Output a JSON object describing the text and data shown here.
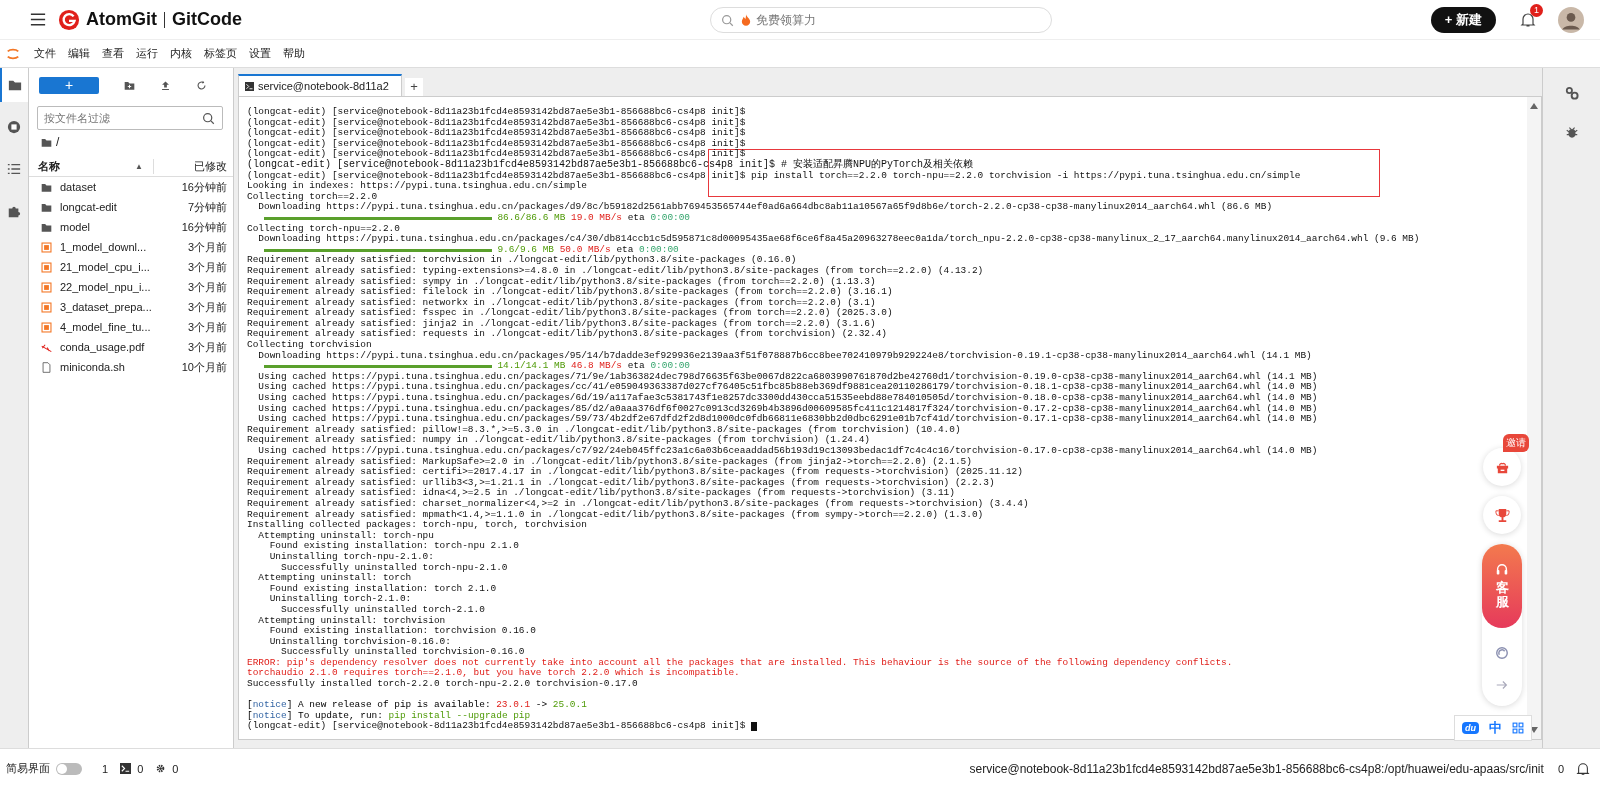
{
  "header": {
    "brand": "AtomGit",
    "brand_secondary": "GitCode",
    "search": {
      "placeholder": "免费领算力"
    },
    "new_button": {
      "icon": "+",
      "label": "新建"
    },
    "notifications": "1"
  },
  "menu": [
    "文件",
    "编辑",
    "查看",
    "运行",
    "内核",
    "标签页",
    "设置",
    "帮助"
  ],
  "activity_bar": [
    {
      "selected": true
    },
    {
      "selected": false
    },
    {
      "selected": false
    },
    {
      "selected": false
    }
  ],
  "file_browser": {
    "new_label": "+",
    "filter": {
      "placeholder": "按文件名过滤"
    },
    "path": "/",
    "columns": {
      "name": "名称",
      "sort": "▲",
      "modified": "已修改"
    },
    "files": [
      {
        "kind": "folder",
        "name": "dataset",
        "modified": "16分钟前"
      },
      {
        "kind": "folder",
        "name": "longcat-edit",
        "modified": "7分钟前"
      },
      {
        "kind": "folder",
        "name": "model",
        "modified": "16分钟前"
      },
      {
        "kind": "notebook",
        "name": "1_model_downl...",
        "modified": "3个月前"
      },
      {
        "kind": "notebook",
        "name": "21_model_cpu_i...",
        "modified": "3个月前"
      },
      {
        "kind": "notebook",
        "name": "22_model_npu_i...",
        "modified": "3个月前"
      },
      {
        "kind": "notebook",
        "name": "3_dataset_prepa...",
        "modified": "3个月前"
      },
      {
        "kind": "notebook",
        "name": "4_model_fine_tu...",
        "modified": "3个月前"
      },
      {
        "kind": "pdf",
        "name": "conda_usage.pdf",
        "modified": "3个月前"
      },
      {
        "kind": "file",
        "name": "miniconda.sh",
        "modified": "10个月前"
      }
    ]
  },
  "tabs": [
    {
      "label": "service@notebook-8d11a2",
      "selected": true
    }
  ],
  "add_tab": "+",
  "terminal": {
    "highlight_box": true,
    "lines": [
      {
        "kind": "out",
        "text": "(longcat-edit) [service@notebook-8d11a23b1fcd4e8593142bd87ae5e3b1-856688bc6-cs4p8 init]$"
      },
      {
        "kind": "out",
        "text": "(longcat-edit) [service@notebook-8d11a23b1fcd4e8593142bd87ae5e3b1-856688bc6-cs4p8 init]$"
      },
      {
        "kind": "out",
        "text": "(longcat-edit) [service@notebook-8d11a23b1fcd4e8593142bd87ae5e3b1-856688bc6-cs4p8 init]$"
      },
      {
        "kind": "out",
        "text": "(longcat-edit) [service@notebook-8d11a23b1fcd4e8593142bd87ae5e3b1-856688bc6-cs4p8 init]$"
      },
      {
        "kind": "out",
        "text": "(longcat-edit) [service@notebook-8d11a23b1fcd4e8593142bd87ae5e3b1-856688bc6-cs4p8 init]$"
      },
      {
        "kind": "out",
        "text": "(longcat-edit) [service@notebook-8d11a23b1fcd4e8593142bd87ae5e3b1-856688bc6-cs4p8 init]$ # 安装适配昇腾NPU的PyTorch及相关依赖"
      },
      {
        "kind": "out",
        "text": "(longcat-edit) [service@notebook-8d11a23b1fcd4e8593142bd87ae5e3b1-856688bc6-cs4p8 init]$ pip install torch==2.2.0 torch-npu==2.2.0 torchvision -i https://pypi.tuna.tsinghua.edu.cn/simple"
      },
      {
        "kind": "out",
        "text": "Looking in indexes: https://pypi.tuna.tsinghua.edu.cn/simple"
      },
      {
        "kind": "out",
        "text": "Collecting torch==2.2.0"
      },
      {
        "kind": "out",
        "text": "  Downloading https://pypi.tuna.tsinghua.edu.cn/packages/d9/8c/b59182d2561abb769453565744ef0ad6a664dbc8ab11a10567a65f9d8b6e/torch-2.2.0-cp38-cp38-manylinux2014_aarch64.whl (86.6 MB)"
      },
      {
        "kind": "progress",
        "level": 1,
        "size": "86.6/86.6 MB",
        "rate": "19.0 MB/s",
        "eta_label": "eta",
        "eta": "0:00:00"
      },
      {
        "kind": "out",
        "text": "Collecting torch-npu==2.2.0"
      },
      {
        "kind": "out",
        "text": "  Downloading https://pypi.tuna.tsinghua.edu.cn/packages/c4/30/db814ccb1c5d595871c8d00095435ae68f6ce6f8a45a20963278eec0a1da/torch_npu-2.2.0-cp38-cp38-manylinux_2_17_aarch64.manylinux2014_aarch64.whl (9.6 MB)"
      },
      {
        "kind": "progress",
        "level": 1,
        "size": "9.6/9.6 MB",
        "rate": "50.0 MB/s",
        "eta_label": "eta",
        "eta": "0:00:00"
      },
      {
        "kind": "out",
        "text": "Requirement already satisfied: torchvision in ./longcat-edit/lib/python3.8/site-packages (0.16.0)"
      },
      {
        "kind": "out",
        "text": "Requirement already satisfied: typing-extensions>=4.8.0 in ./longcat-edit/lib/python3.8/site-packages (from torch==2.2.0) (4.13.2)"
      },
      {
        "kind": "out",
        "text": "Requirement already satisfied: sympy in ./longcat-edit/lib/python3.8/site-packages (from torch==2.2.0) (1.13.3)"
      },
      {
        "kind": "out",
        "text": "Requirement already satisfied: filelock in ./longcat-edit/lib/python3.8/site-packages (from torch==2.2.0) (3.16.1)"
      },
      {
        "kind": "out",
        "text": "Requirement already satisfied: networkx in ./longcat-edit/lib/python3.8/site-packages (from torch==2.2.0) (3.1)"
      },
      {
        "kind": "out",
        "text": "Requirement already satisfied: fsspec in ./longcat-edit/lib/python3.8/site-packages (from torch==2.2.0) (2025.3.0)"
      },
      {
        "kind": "out",
        "text": "Requirement already satisfied: jinja2 in ./longcat-edit/lib/python3.8/site-packages (from torch==2.2.0) (3.1.6)"
      },
      {
        "kind": "out",
        "text": "Requirement already satisfied: requests in ./longcat-edit/lib/python3.8/site-packages (from torchvision) (2.32.4)"
      },
      {
        "kind": "out",
        "text": "Collecting torchvision"
      },
      {
        "kind": "out",
        "text": "  Downloading https://pypi.tuna.tsinghua.edu.cn/packages/95/14/b7dadde3ef929936e2139aa3f51f078887b6cc8bee702410979b929224e8/torchvision-0.19.1-cp38-cp38-manylinux2014_aarch64.whl (14.1 MB)"
      },
      {
        "kind": "progress",
        "level": 1,
        "size": "14.1/14.1 MB",
        "rate": "46.8 MB/s",
        "eta_label": "eta",
        "eta": "0:00:00"
      },
      {
        "kind": "out",
        "text": "  Using cached https://pypi.tuna.tsinghua.edu.cn/packages/71/9e/1ab363824dec798d76635f63be0067d822ca6803990761870d2be42760d1/torchvision-0.19.0-cp38-cp38-manylinux2014_aarch64.whl (14.1 MB)"
      },
      {
        "kind": "out",
        "text": "  Using cached https://pypi.tuna.tsinghua.edu.cn/packages/cc/41/e059049363387d027cf76405c51fbc85b88eb369df9881cea20110286179/torchvision-0.18.1-cp38-cp38-manylinux2014_aarch64.whl (14.0 MB)"
      },
      {
        "kind": "out",
        "text": "  Using cached https://pypi.tuna.tsinghua.edu.cn/packages/6d/19/a117afae3c5381743f1e8257dc3300dd430cca51535eebd88e784010505d/torchvision-0.18.0-cp38-cp38-manylinux2014_aarch64.whl (14.0 MB)"
      },
      {
        "kind": "out",
        "text": "  Using cached https://pypi.tuna.tsinghua.edu.cn/packages/85/d2/a0aaa376df6f0027c0913cd3269b4b3896d00609585fc411c1214817f324/torchvision-0.17.2-cp38-cp38-manylinux2014_aarch64.whl (14.0 MB)"
      },
      {
        "kind": "out",
        "text": "  Using cached https://pypi.tuna.tsinghua.edu.cn/packages/59/73/4b2df2e67dfd2f2d8d1000dc0fdb66811e6830bb2d0dbc6291e01b7cf41d/torchvision-0.17.1-cp38-cp38-manylinux2014_aarch64.whl (14.0 MB)"
      },
      {
        "kind": "out",
        "text": "Requirement already satisfied: pillow!=8.3.*,>=5.3.0 in ./longcat-edit/lib/python3.8/site-packages (from torchvision) (10.4.0)"
      },
      {
        "kind": "out",
        "text": "Requirement already satisfied: numpy in ./longcat-edit/lib/python3.8/site-packages (from torchvision) (1.24.4)"
      },
      {
        "kind": "out",
        "text": "  Using cached https://pypi.tuna.tsinghua.edu.cn/packages/c7/92/24eb045ffc23a1c6a03b6ceaaddad56b193d19c13093bedac1df7c4c4c16/torchvision-0.17.0-cp38-cp38-manylinux2014_aarch64.whl (14.0 MB)"
      },
      {
        "kind": "out",
        "text": "Requirement already satisfied: MarkupSafe>=2.0 in ./longcat-edit/lib/python3.8/site-packages (from jinja2->torch==2.2.0) (2.1.5)"
      },
      {
        "kind": "out",
        "text": "Requirement already satisfied: certifi>=2017.4.17 in ./longcat-edit/lib/python3.8/site-packages (from requests->torchvision) (2025.11.12)"
      },
      {
        "kind": "out",
        "text": "Requirement already satisfied: urllib3<3,>=1.21.1 in ./longcat-edit/lib/python3.8/site-packages (from requests->torchvision) (2.2.3)"
      },
      {
        "kind": "out",
        "text": "Requirement already satisfied: idna<4,>=2.5 in ./longcat-edit/lib/python3.8/site-packages (from requests->torchvision) (3.11)"
      },
      {
        "kind": "out",
        "text": "Requirement already satisfied: charset_normalizer<4,>=2 in ./longcat-edit/lib/python3.8/site-packages (from requests->torchvision) (3.4.4)"
      },
      {
        "kind": "out",
        "text": "Requirement already satisfied: mpmath<1.4,>=1.1.0 in ./longcat-edit/lib/python3.8/site-packages (from sympy->torch==2.2.0) (1.3.0)"
      },
      {
        "kind": "out",
        "text": "Installing collected packages: torch-npu, torch, torchvision"
      },
      {
        "kind": "out",
        "text": "  Attempting uninstall: torch-npu"
      },
      {
        "kind": "out",
        "text": "    Found existing installation: torch-npu 2.1.0"
      },
      {
        "kind": "out",
        "text": "    Uninstalling torch-npu-2.1.0:"
      },
      {
        "kind": "out",
        "text": "      Successfully uninstalled torch-npu-2.1.0"
      },
      {
        "kind": "out",
        "text": "  Attempting uninstall: torch"
      },
      {
        "kind": "out",
        "text": "    Found existing installation: torch 2.1.0"
      },
      {
        "kind": "out",
        "text": "    Uninstalling torch-2.1.0:"
      },
      {
        "kind": "out",
        "text": "      Successfully uninstalled torch-2.1.0"
      },
      {
        "kind": "out",
        "text": "  Attempting uninstall: torchvision"
      },
      {
        "kind": "out",
        "text": "    Found existing installation: torchvision 0.16.0"
      },
      {
        "kind": "out",
        "text": "    Uninstalling torchvision-0.16.0:"
      },
      {
        "kind": "out",
        "text": "      Successfully uninstalled torchvision-0.16.0"
      },
      {
        "kind": "error",
        "text": "ERROR: pip's dependency resolver does not currently take into account all the packages that are installed. This behaviour is the source of the following dependency conflicts."
      },
      {
        "kind": "error",
        "text": "torchaudio 2.1.0 requires torch==2.1.0, but you have torch 2.2.0 which is incompatible."
      },
      {
        "kind": "out",
        "text": "Successfully installed torch-2.2.0 torch-npu-2.2.0 torchvision-0.17.0"
      },
      {
        "kind": "blank"
      },
      {
        "kind": "parts",
        "parts": [
          {
            "kind": "plain",
            "text": "["
          },
          {
            "kind": "tag",
            "text": "notice"
          },
          {
            "kind": "plain",
            "text": "] A new release of pip is available: "
          },
          {
            "kind": "old",
            "text": "23.0.1"
          },
          {
            "kind": "plain",
            "text": " -> "
          },
          {
            "kind": "new",
            "text": "25.0.1"
          }
        ]
      },
      {
        "kind": "parts",
        "parts": [
          {
            "kind": "plain",
            "text": "["
          },
          {
            "kind": "tag",
            "text": "notice"
          },
          {
            "kind": "plain",
            "text": "] To update, run: "
          },
          {
            "kind": "new",
            "text": "pip install --upgrade pip"
          }
        ]
      },
      {
        "kind": "cursor",
        "text": "(longcat-edit) [service@notebook-8d11a23b1fcd4e8593142bd87ae5e3b1-856688bc6-cs4p8 init]$ "
      }
    ]
  },
  "floating": {
    "invite": "邀请",
    "support": "客服",
    "baidu": {
      "logo": "du",
      "lang": "中"
    }
  },
  "status_bar": {
    "simple_mode": {
      "label": "简易界面",
      "on": false
    },
    "counts": [
      "1",
      "0",
      "0"
    ],
    "path": "service@notebook-8d11a23b1fcd4e8593142bd87ae5e3b1-856688bc6-cs4p8:/opt/huawei/edu-apaas/src/init",
    "notifications": "0"
  }
}
